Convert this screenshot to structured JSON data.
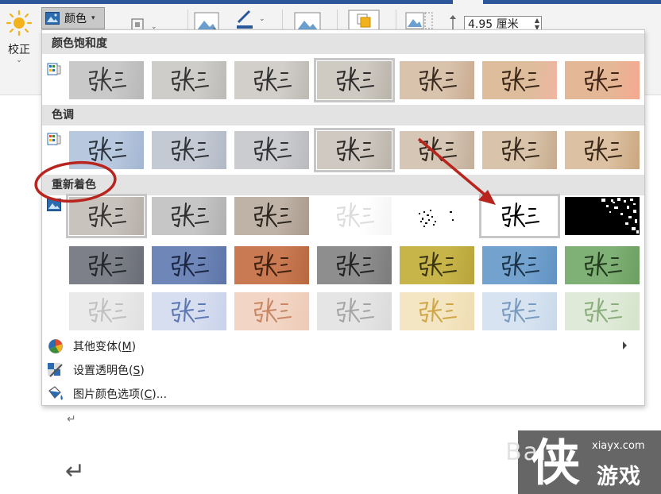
{
  "ribbon": {
    "corrections_label": "校正",
    "color_label": "颜色",
    "size_value": "4.95 厘米",
    "accent": "#2b579a"
  },
  "sections": [
    {
      "title": "颜色饱和度",
      "thumbs": [
        {
          "bg": "#c9c9c9",
          "ink": "#3a3a3a",
          "tint": "#b8b8b8",
          "state": "normal"
        },
        {
          "bg": "#cfcdca",
          "ink": "#333333",
          "tint": "#bcbab6",
          "state": "normal"
        },
        {
          "bg": "#d2cfca",
          "ink": "#303030",
          "tint": "#bdb9b3",
          "state": "normal"
        },
        {
          "bg": "#cfcac2",
          "ink": "#2c2c2c",
          "tint": "#b9b3aa",
          "state": "selected"
        },
        {
          "bg": "#d9c3ad",
          "ink": "#3a2a20",
          "tint": "#c9ab90",
          "state": "normal"
        },
        {
          "bg": "#ddbd9c",
          "ink": "#3d2718",
          "tint": "#f0b6a0",
          "state": "normal"
        },
        {
          "bg": "#e4b896",
          "ink": "#402314",
          "tint": "#f6a890",
          "state": "normal"
        }
      ]
    },
    {
      "title": "色调",
      "thumbs": [
        {
          "bg": "#b8c8de",
          "ink": "#2d3540",
          "tint": "#a3b6d2",
          "state": "normal"
        },
        {
          "bg": "#c4cad4",
          "ink": "#2f3338",
          "tint": "#b2b9c5",
          "state": "normal"
        },
        {
          "bg": "#cbcccf",
          "ink": "#303133",
          "tint": "#babbbe",
          "state": "normal"
        },
        {
          "bg": "#cfc9c1",
          "ink": "#2e2c29",
          "tint": "#bab3a9",
          "state": "selected"
        },
        {
          "bg": "#d6c6b5",
          "ink": "#33291f",
          "tint": "#c2ae99",
          "state": "normal"
        },
        {
          "bg": "#d9c4ab",
          "ink": "#35271a",
          "tint": "#c6ab8c",
          "state": "normal"
        },
        {
          "bg": "#dcc1a2",
          "ink": "#382514",
          "tint": "#caa67f",
          "state": "normal"
        }
      ]
    },
    {
      "title": "重新着色",
      "thumbs": [
        {
          "bg": "#c8c3bd",
          "ink": "#383431",
          "tint": "#b5afa8",
          "state": "selected"
        },
        {
          "bg": "#c6c6c6",
          "ink": "#2e2e2e",
          "tint": "#b0b0b0",
          "state": "normal"
        },
        {
          "bg": "#bfb2a6",
          "ink": "#2d261f",
          "tint": "#a99a8c",
          "state": "normal"
        },
        {
          "bg": "#ffffff",
          "ink": "#dcdcdc",
          "tint": "#f4f4f4",
          "state": "normal"
        },
        {
          "bg": "#ffffff",
          "ink": "#111111",
          "tint": "#ffffff",
          "state": "speckle"
        },
        {
          "bg": "#ffffff",
          "ink": "#000000",
          "tint": "#ffffff",
          "state": "selected-bw"
        },
        {
          "bg": "#000000",
          "ink": "#ffffff",
          "tint": "#000000",
          "state": "inverted"
        },
        {
          "bg": "#7d8088",
          "ink": "#23262c",
          "tint": "#6a6d76",
          "state": "normal"
        },
        {
          "bg": "#6f86b8",
          "ink": "#1b2643",
          "tint": "#5d74a8",
          "state": "normal"
        },
        {
          "bg": "#c97a52",
          "ink": "#40200f",
          "tint": "#b8683f",
          "state": "normal"
        },
        {
          "bg": "#8e8e8e",
          "ink": "#222222",
          "tint": "#7c7c7c",
          "state": "normal"
        },
        {
          "bg": "#c8b54a",
          "ink": "#3a3410",
          "tint": "#b7a43a",
          "state": "normal"
        },
        {
          "bg": "#73a2cf",
          "ink": "#1a3348",
          "tint": "#6292c2",
          "state": "normal"
        },
        {
          "bg": "#7fb075",
          "ink": "#21391c",
          "tint": "#6c9f62",
          "state": "normal"
        },
        {
          "bg": "#eaeaea",
          "ink": "#b9b9b9",
          "tint": "#e0e0e0",
          "state": "normal"
        },
        {
          "bg": "#d7def0",
          "ink": "#4967a8",
          "tint": "#c9d2ea",
          "state": "normal"
        },
        {
          "bg": "#f2d5c4",
          "ink": "#c07a55",
          "tint": "#eccbb7",
          "state": "normal"
        },
        {
          "bg": "#e5e5e5",
          "ink": "#9a9a9a",
          "tint": "#dadada",
          "state": "normal"
        },
        {
          "bg": "#f4e6c2",
          "ink": "#c99b35",
          "tint": "#efdcb1",
          "state": "normal"
        },
        {
          "bg": "#d7e3f0",
          "ink": "#6a8fb8",
          "tint": "#c9d9ea",
          "state": "normal"
        },
        {
          "bg": "#dfead8",
          "ink": "#7da36e",
          "tint": "#d4e3cb",
          "state": "normal"
        }
      ]
    }
  ],
  "thumb_text": "张三",
  "menu": [
    {
      "label_main": "其他变体(",
      "label_key": "M",
      "label_tail": ")",
      "has_submenu": true,
      "icon": "palette-icon"
    },
    {
      "label_main": "设置透明色(",
      "label_key": "S",
      "label_tail": ")",
      "has_submenu": false,
      "icon": "set-transparent-icon"
    },
    {
      "label_main": "图片颜色选项(",
      "label_key": "C",
      "label_tail": ")...",
      "has_submenu": false,
      "icon": "color-options-icon"
    }
  ],
  "annotation": {
    "color": "#b8251f"
  },
  "watermark": {
    "url": "xiayx.com",
    "big_char": "侠",
    "name": "游戏",
    "faint": "Bai"
  }
}
